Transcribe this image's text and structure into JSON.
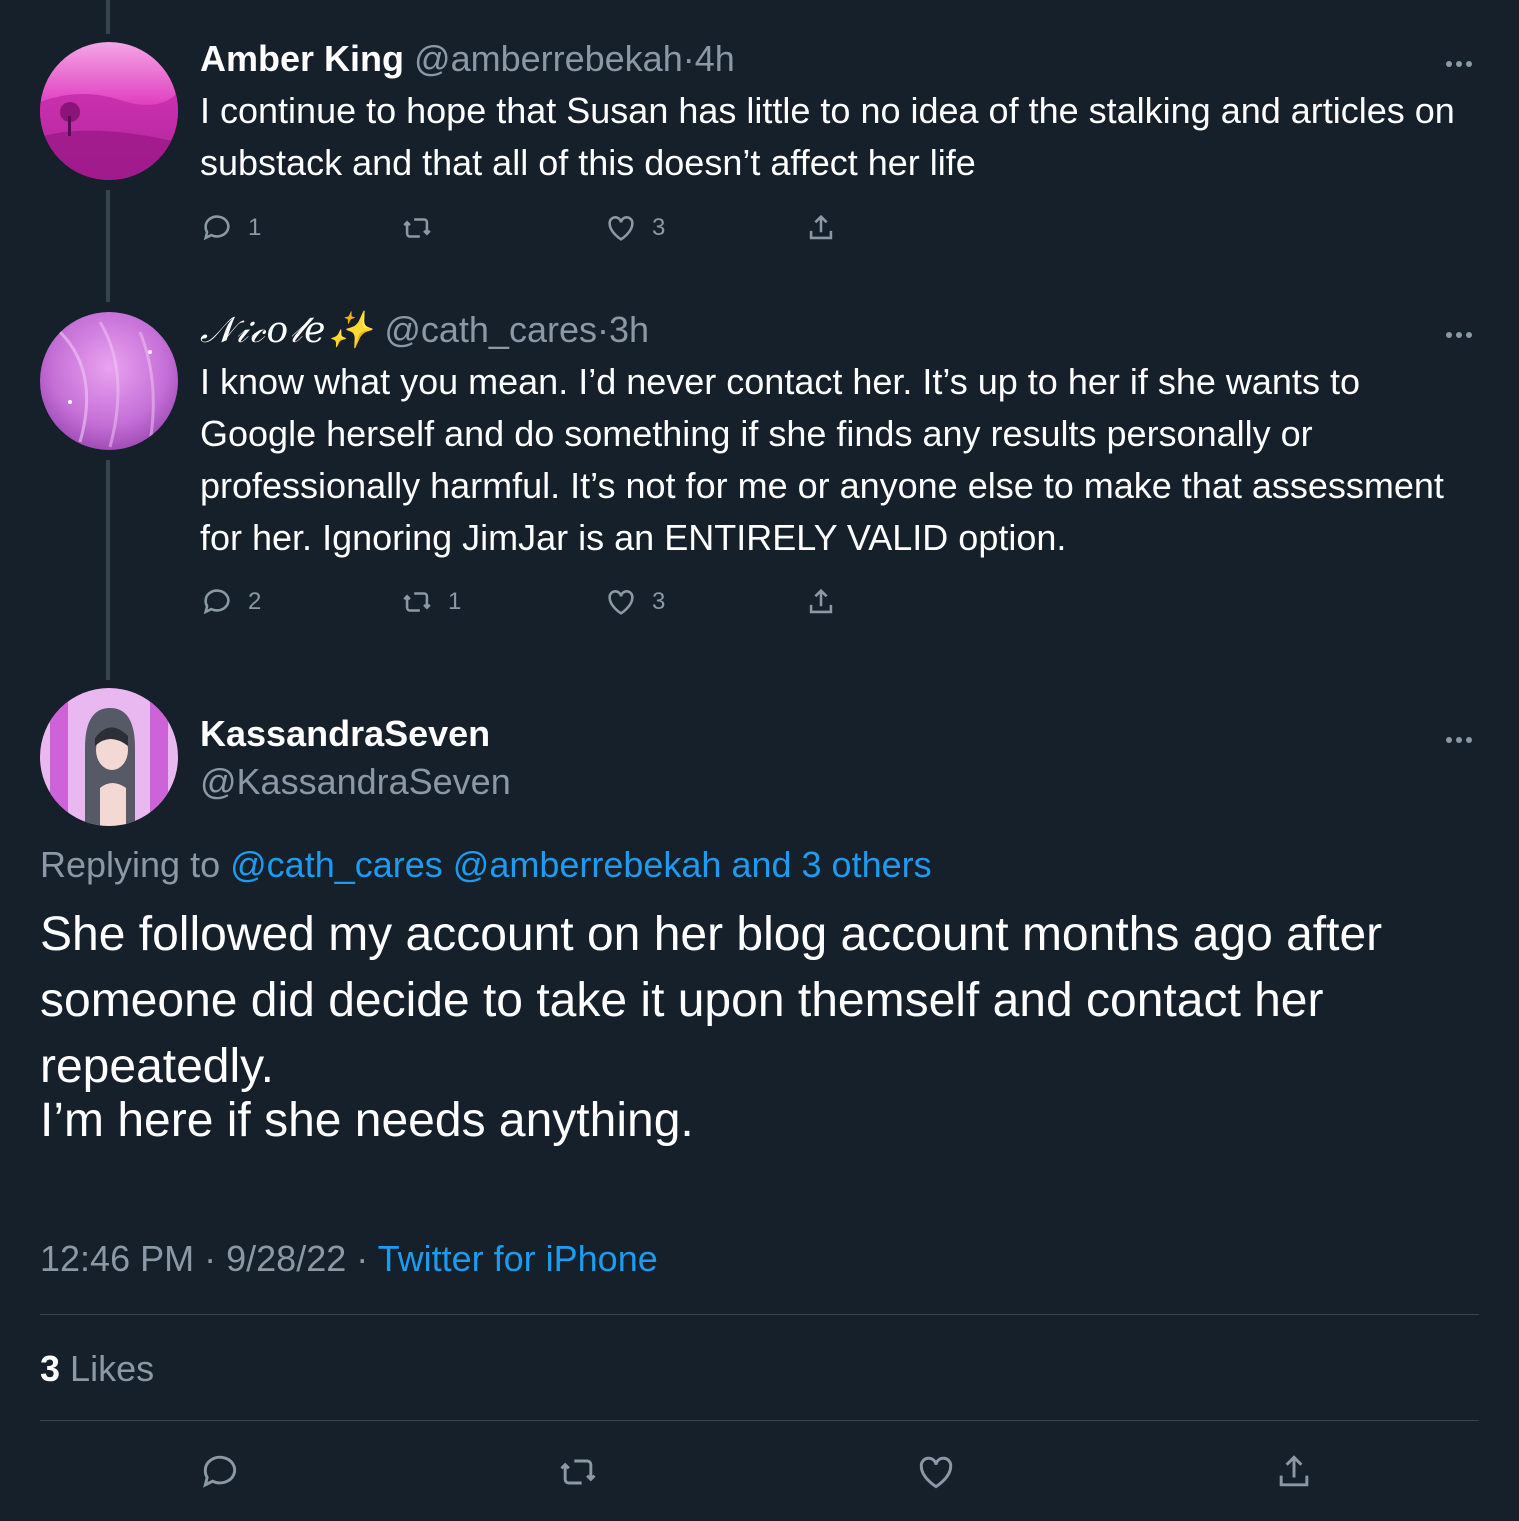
{
  "tweets": [
    {
      "name": "Amber King",
      "handle": "@amberrebekah",
      "time": "4h",
      "text": "I continue to hope that Susan has little to no idea of the stalking and articles on substack and that all of this doesn’t affect her life",
      "replies": "1",
      "retweets": "",
      "likes": "3"
    },
    {
      "name": "𝒩𝒾𝒸𝑜𝓁𝑒✨",
      "handle": "@cath_cares",
      "time": "3h",
      "text": "I know what you mean. I’d never contact her. It’s up to her if she wants to Google herself and do something if she finds any results personally or professionally harmful. It’s not for me or anyone else to make that assessment for her. Ignoring JimJar is an ENTIRELY VALID option.",
      "replies": "2",
      "retweets": "1",
      "likes": "3"
    }
  ],
  "main": {
    "name": "KassandraSeven",
    "handle": "@KassandraSeven",
    "replying_label": "Replying to",
    "replying_links": "@cath_cares @amberrebekah and 3 others",
    "paragraph1": "She followed my account on her blog account months ago after someone did decide to take it upon themself and contact her repeatedly.",
    "paragraph2": "I’m here if she needs anything.",
    "time": "12:46 PM",
    "date": "9/28/22",
    "source": "Twitter for iPhone",
    "like_count": "3",
    "like_label": "Likes"
  },
  "separator": "·",
  "colors": {
    "background": "#15202b",
    "text": "#ffffff",
    "secondary": "#8b98a5",
    "link": "#1d9bf0",
    "divider": "#38444d"
  }
}
